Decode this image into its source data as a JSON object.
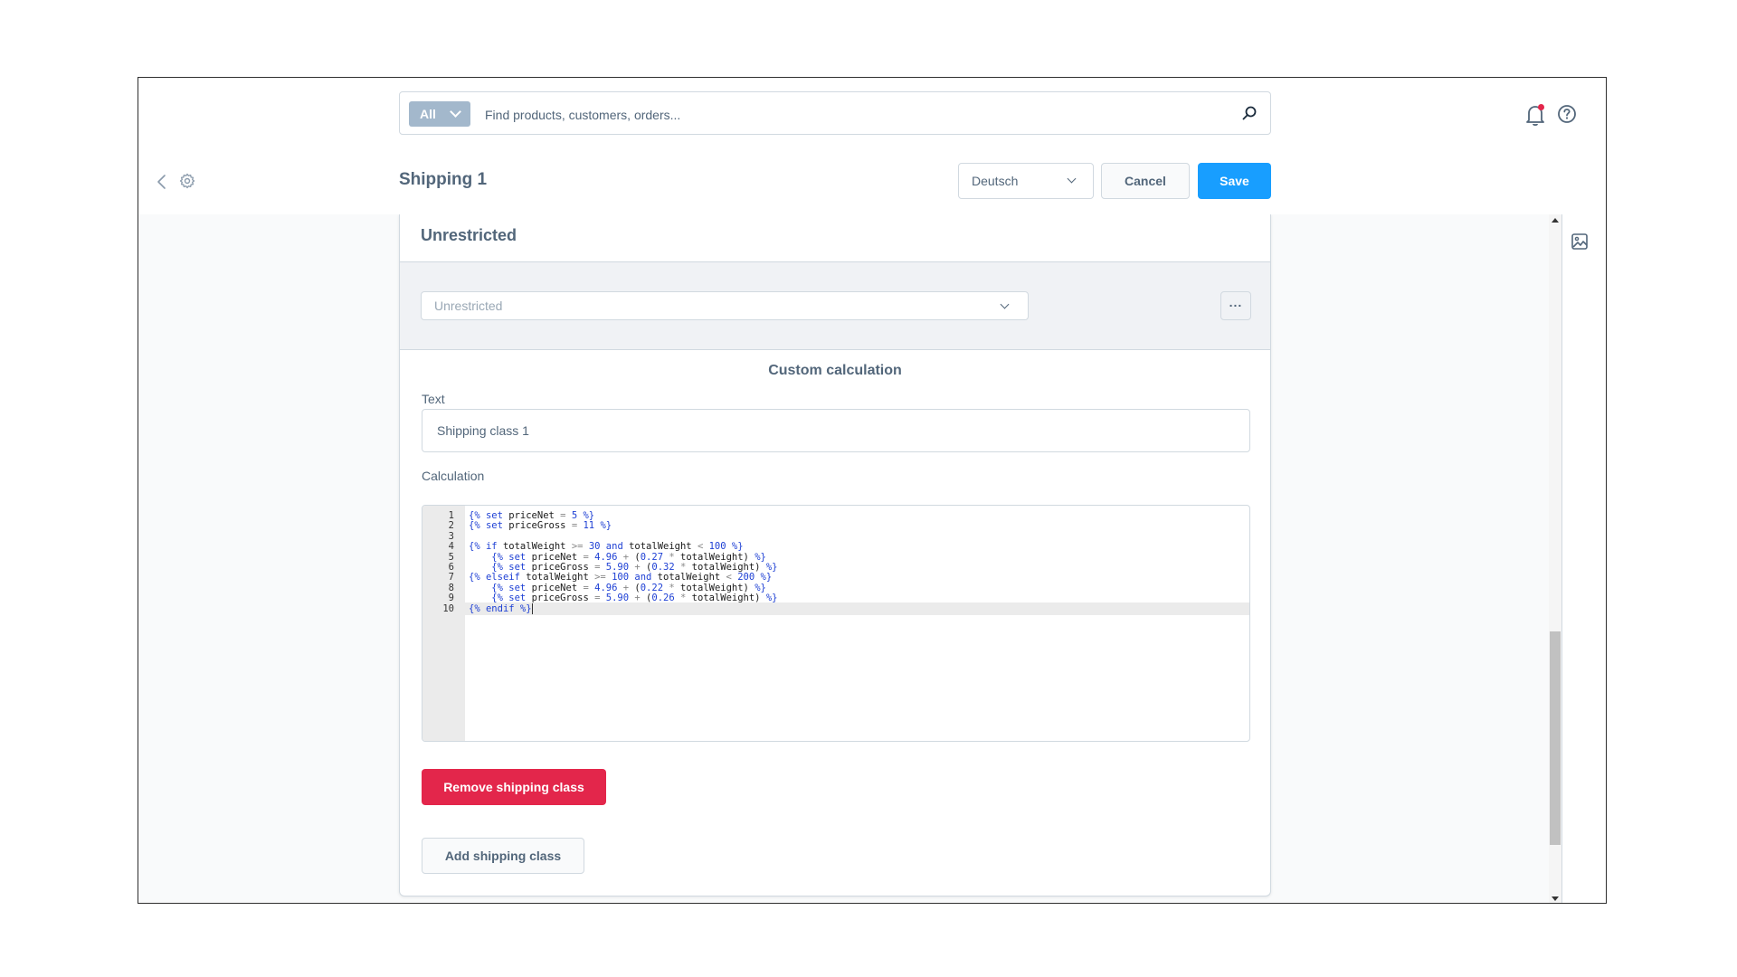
{
  "header": {
    "search_type": "All",
    "search_placeholder": "Find products, customers, orders..."
  },
  "actionbar": {
    "title": "Shipping 1",
    "language": "Deutsch",
    "cancel_label": "Cancel",
    "save_label": "Save"
  },
  "card": {
    "title": "Unrestricted",
    "rule_select_value": "Unrestricted",
    "more_label": "...",
    "section_title": "Custom calculation",
    "text_label": "Text",
    "text_value": "Shipping class 1",
    "calculation_label": "Calculation",
    "code_lines": [
      "{% set priceNet = 5 %}",
      "{% set priceGross = 11 %}",
      "",
      "{% if totalWeight >= 30 and totalWeight < 100 %}",
      "    {% set priceNet = 4.96 + (0.27 * totalWeight) %}",
      "    {% set priceGross = 5.90 + (0.32 * totalWeight) %}",
      "{% elseif totalWeight >= 100 and totalWeight < 200 %}",
      "    {% set priceNet = 4.96 + (0.22 * totalWeight) %}",
      "    {% set priceGross = 5.90 + (0.26 * totalWeight) %}",
      "{% endif %}"
    ],
    "active_line": 10,
    "remove_label": "Remove shipping class",
    "add_label": "Add shipping class"
  },
  "icons": {
    "search": "magnifier-icon",
    "bell": "bell-icon",
    "help": "help-icon",
    "back": "chevron-left-icon",
    "settings": "gear-icon",
    "image": "image-icon"
  },
  "colors": {
    "primary": "#189eff",
    "danger": "#e3264b",
    "search_type_bg": "#a3b8cc",
    "text": "#52667a"
  }
}
